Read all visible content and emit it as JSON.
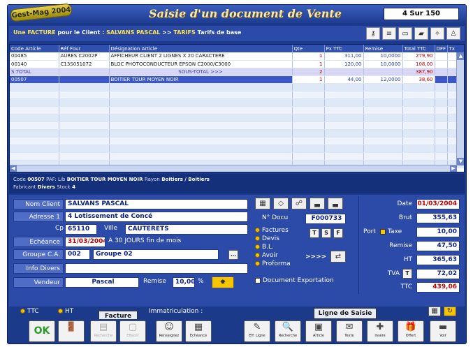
{
  "app": {
    "badge": "Gest-Mag 2004",
    "title": "Saisie d'un document de Vente",
    "record_counter": "4 Sur 150"
  },
  "infobar": {
    "doc_type": "Une FACTURE",
    "pour_le_client": "pour le Client :",
    "client": "SALVANS PASCAL",
    "arrows": ">>",
    "tarif_code": "TARIFS",
    "tarif_label": "Tarifs de base"
  },
  "grid": {
    "columns": [
      "Code Article",
      "Réf Four",
      "Désignation Article",
      "Qte",
      "Px TTC",
      "Remise",
      "Total TTC",
      "OFF",
      "Tx"
    ],
    "rows": [
      {
        "code": "00485",
        "ref": "AURES C2002P",
        "designation": "AFFICHEUR CLIENT 2 LIGNES X 20 CARACTERE",
        "qte": "1",
        "px": "311,00",
        "remise": "10,0000",
        "total": "279,90",
        "type": "normal"
      },
      {
        "code": "00140",
        "ref": "C13S051072",
        "designation": "BLOC PHOTOCONDUCTEUR EPSON C2000/C3000",
        "qte": "1",
        "px": "120,00",
        "remise": "10,0000",
        "total": "108,00",
        "type": "normal"
      },
      {
        "code": "S.TOTAL",
        "ref": "",
        "designation": "SOUS-TOTAL >>>",
        "qte": "2",
        "px": "",
        "remise": "",
        "total": "387,90",
        "type": "subtotal"
      },
      {
        "code": "00507",
        "ref": "",
        "designation": "BOITIER TOUR MOYEN NOIR",
        "qte": "1",
        "px": "44,00",
        "remise": "12,0000",
        "total": "38,60",
        "type": "selected"
      }
    ]
  },
  "article_strip": {
    "code_label": "Code",
    "code": "00507",
    "paf_label": "PAF:",
    "lib_label": "Lib",
    "lib": "BOITIER TOUR MOYEN NOIR",
    "rayon_label": "Rayon",
    "rayon": "Boitiers / Boitiers",
    "fabricant_label": "Fabricant",
    "fabricant": "Divers",
    "stock_label": "Stock",
    "stock": "4"
  },
  "form": {
    "nom_label": "Nom Client",
    "nom": "SALVANS PASCAL",
    "adresse_label": "Adresse 1",
    "adresse": "4 Lotissement de Concé",
    "cp_label": "Cp",
    "cp": "65110",
    "ville_label": "Ville",
    "ville": "CAUTERETS",
    "echeance_label": "Echéance",
    "echeance": "31/03/2004",
    "echeance_terms": "A 30 JOURS fin de mois",
    "groupe_label": "Groupe C.A.",
    "groupe_code": "002",
    "groupe_name": "Groupe 02",
    "info_label": "Info Divers",
    "info": "",
    "vendeur_label": "Vendeur",
    "vendeur": "Pascal",
    "remise_label": "Remise",
    "remise": "10,00",
    "remise_unit": "%",
    "ndocu_label": "N° Docu",
    "ndocu": "F000733",
    "doc_types": [
      "Factures",
      "Devis",
      "B.L.",
      "Avoir",
      "Proforma"
    ],
    "doc_type_selected": "Factures",
    "tsf": [
      "T",
      "S",
      "F"
    ],
    "avoir_arrows": ">>>>",
    "export_label": "Document Exportation"
  },
  "totals": {
    "date_label": "Date",
    "date": "01/03/2004",
    "brut_label": "Brut",
    "brut": "355,63",
    "port_label": "Port",
    "taxe_label": "Taxe",
    "port": "10,00",
    "remise_label": "Remise",
    "remise": "47,50",
    "ht_label": "HT",
    "ht": "365,63",
    "tva_label": "TVA",
    "tva_code": "T",
    "tva": "72,02",
    "ttc_label": "TTC",
    "ttc": "439,06"
  },
  "bottom_line": {
    "ttc_radio": "TTC",
    "ht_radio": "HT",
    "immatriculation_label": "Immatriculation :",
    "facture_tab": "Facture",
    "ligne_tab": "Ligne de Saisie"
  },
  "footer": {
    "ok": "OK",
    "buttons_left": [
      {
        "icon": "exit-icon",
        "glyph": "🚪",
        "label": ""
      },
      {
        "icon": "search-client-icon",
        "glyph": "▤",
        "label": "Recherche"
      },
      {
        "icon": "delete-icon",
        "glyph": "▢",
        "label": "Effacer"
      },
      {
        "icon": "client-icon",
        "glyph": "☺",
        "label": "Renseignez"
      },
      {
        "icon": "echeance-icon",
        "glyph": "▦",
        "label": "Echéance"
      }
    ],
    "buttons_right": [
      {
        "icon": "erase-line-icon",
        "glyph": "✎",
        "label": "Eff. Ligne"
      },
      {
        "icon": "search-article-icon",
        "glyph": "🔍",
        "label": "Recherche"
      },
      {
        "icon": "article-icon",
        "glyph": "▣",
        "label": "Article"
      },
      {
        "icon": "text-icon",
        "glyph": "✉",
        "label": "Texte"
      },
      {
        "icon": "insert-icon",
        "glyph": "✚",
        "label": "Insère"
      },
      {
        "icon": "offer-icon",
        "glyph": "🎁",
        "label": "Offert"
      },
      {
        "icon": "view-icon",
        "glyph": "▬",
        "label": "Voir"
      }
    ]
  }
}
